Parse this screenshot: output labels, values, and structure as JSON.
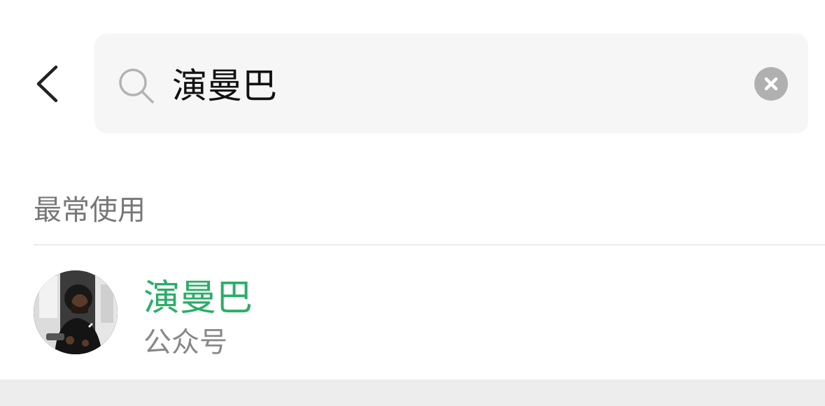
{
  "header": {
    "back_icon": "chevron-left-icon"
  },
  "search": {
    "icon": "search-icon",
    "value": "演曼巴",
    "clear_icon": "clear-icon"
  },
  "section": {
    "title": "最常使用"
  },
  "results": [
    {
      "name": "演曼巴",
      "type": "公众号",
      "avatar_icon": "avatar"
    }
  ],
  "colors": {
    "accent_green": "#2aae67",
    "search_bg": "#f6f6f6",
    "muted_text": "#777777",
    "footer_bg": "#ededed"
  }
}
